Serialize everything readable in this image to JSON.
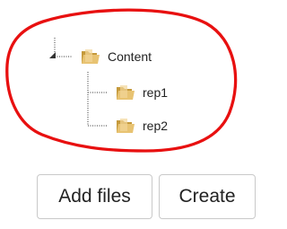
{
  "tree": {
    "root": {
      "label": "Content",
      "icon": "folder-icon",
      "expander_icon": "tree-expander-icon"
    },
    "children": [
      {
        "label": "rep1",
        "icon": "folder-icon"
      },
      {
        "label": "rep2",
        "icon": "folder-icon"
      }
    ]
  },
  "actions": {
    "add_files_label": "Add files",
    "create_label": "Create"
  },
  "colors": {
    "annotation_red": "#e81010",
    "folder_body": "#e3bd69",
    "folder_dark": "#c59a3c",
    "button_border": "#c9c9c9"
  }
}
